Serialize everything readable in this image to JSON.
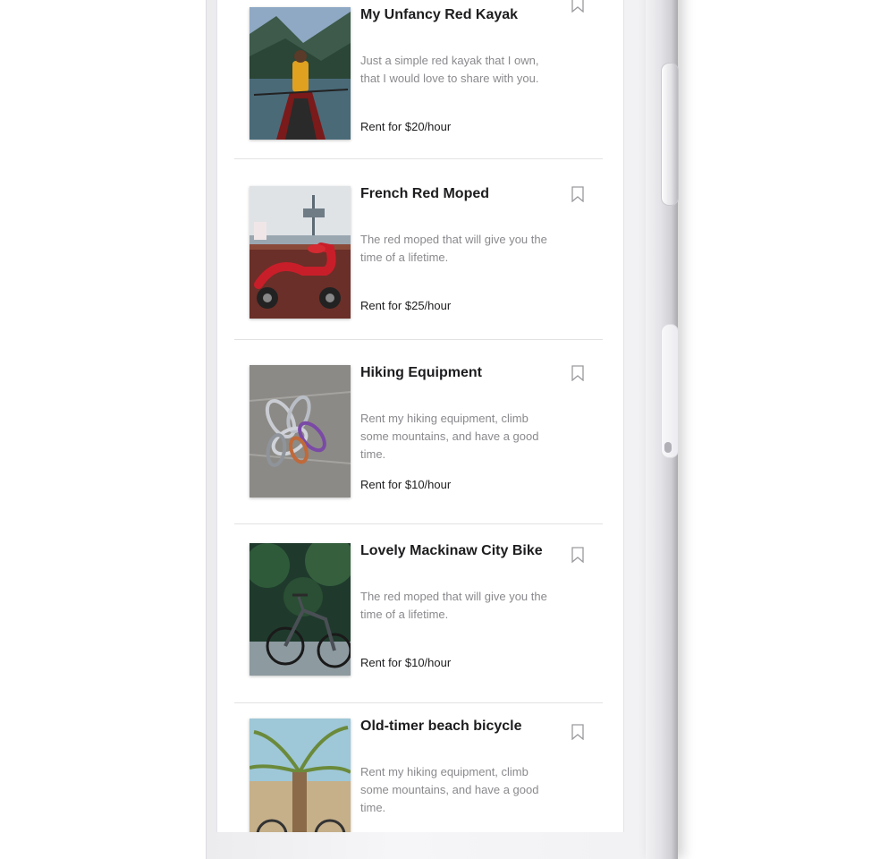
{
  "listings": [
    {
      "title": "My Unfancy Red Kayak",
      "description": "Just a simple red kayak that I own, that I would love to share with you.",
      "price": "Rent for $20/hour",
      "image": "kayak-photo"
    },
    {
      "title": "French Red Moped",
      "description": "The red moped that will give you the time of a lifetime.",
      "price": "Rent for $25/hour",
      "image": "moped-photo"
    },
    {
      "title": "Hiking Equipment",
      "description": "Rent my hiking equipment, climb some mountains, and have a good time.",
      "price": "Rent for $10/hour",
      "image": "carabiners-photo"
    },
    {
      "title": "Lovely Mackinaw City Bike",
      "description": "The red moped that will give you the time of a lifetime.",
      "price": "Rent for $10/hour",
      "image": "bicycle-photo"
    },
    {
      "title": "Old-timer beach bicycle",
      "description": "Rent my hiking equipment, climb some mountains, and have a good time.",
      "price": "",
      "image": "beach-bicycle-photo"
    }
  ],
  "icons": {
    "bookmark": "bookmark-icon"
  }
}
